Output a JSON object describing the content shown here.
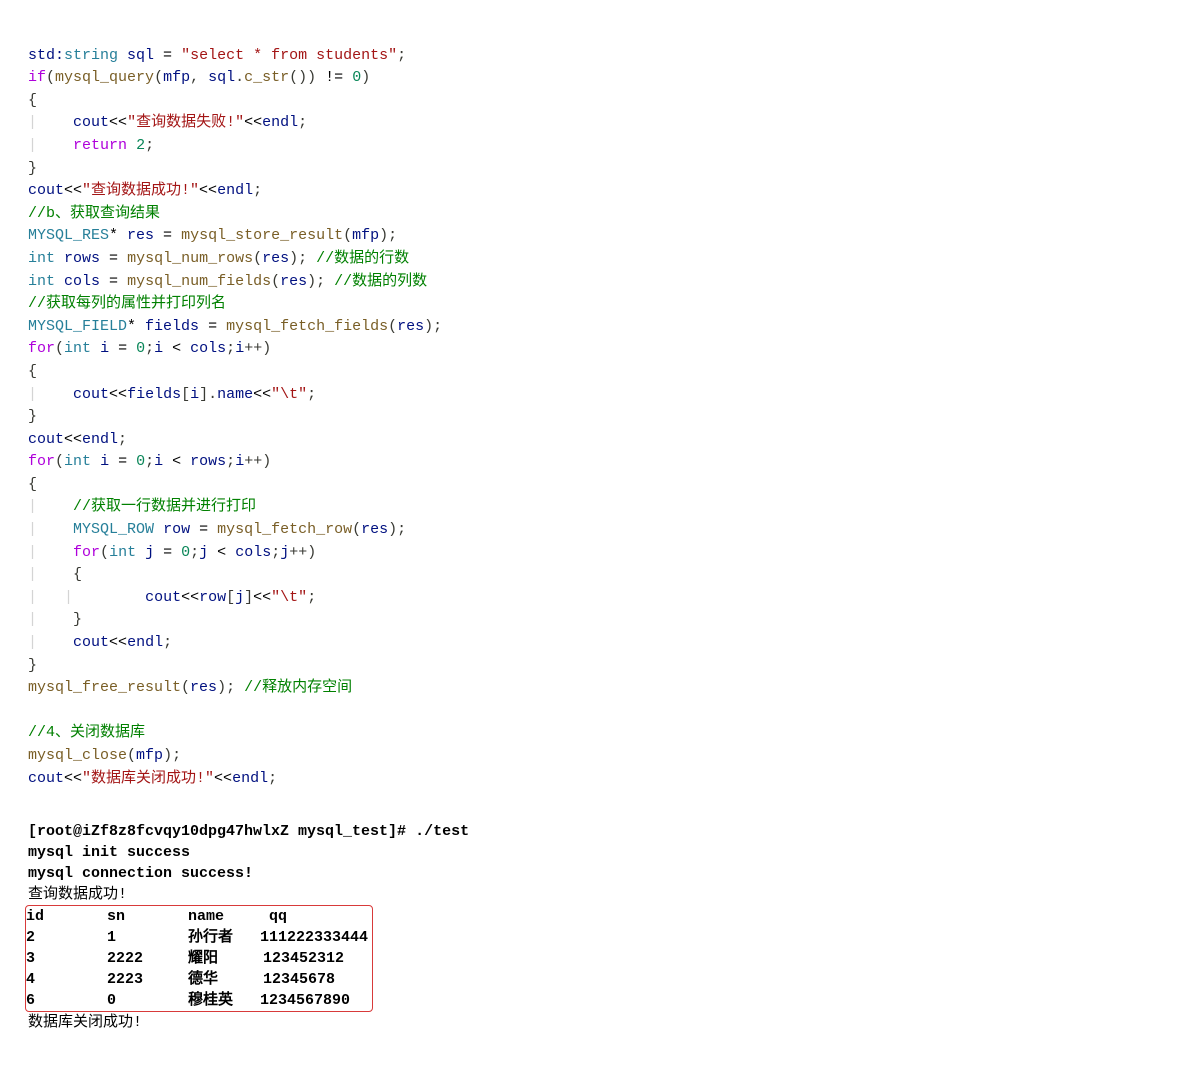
{
  "code": {
    "l01a": "std:",
    "l01b": "string",
    "l01c": " sql ",
    "l01d": "=",
    "l01e": " ",
    "l01f": "\"select * from students\"",
    "l01g": ";",
    "l02a": "if",
    "l02b": "(",
    "l02c": "mysql_query",
    "l02d": "(",
    "l02e": "mfp",
    "l02f": ", ",
    "l02g": "sql",
    "l02h": ".",
    "l02i": "c_str",
    "l02j": "()) ",
    "l02k": "!=",
    "l02l": " ",
    "l02m": "0",
    "l02n": ")",
    "l03": "{",
    "l04a": "    ",
    "l04b": "cout",
    "l04c": "<<",
    "l04d": "\"查询数据失败!\"",
    "l04e": "<<",
    "l04f": "endl",
    "l04g": ";",
    "l05a": "    ",
    "l05b": "return",
    "l05c": " ",
    "l05d": "2",
    "l05e": ";",
    "l06": "}",
    "l07a": "cout",
    "l07b": "<<",
    "l07c": "\"查询数据成功!\"",
    "l07d": "<<",
    "l07e": "endl",
    "l07f": ";",
    "l08": "//b、获取查询结果",
    "l09a": "MYSQL_RES",
    "l09b": "* ",
    "l09c": "res",
    "l09d": " = ",
    "l09e": "mysql_store_result",
    "l09f": "(",
    "l09g": "mfp",
    "l09h": ");",
    "l10a": "int",
    "l10b": " ",
    "l10c": "rows",
    "l10d": " = ",
    "l10e": "mysql_num_rows",
    "l10f": "(",
    "l10g": "res",
    "l10h": "); ",
    "l10i": "//数据的行数",
    "l11a": "int",
    "l11b": " ",
    "l11c": "cols",
    "l11d": " = ",
    "l11e": "mysql_num_fields",
    "l11f": "(",
    "l11g": "res",
    "l11h": "); ",
    "l11i": "//数据的列数",
    "l12": "//获取每列的属性并打印列名",
    "l13a": "MYSQL_FIELD",
    "l13b": "* ",
    "l13c": "fields",
    "l13d": " = ",
    "l13e": "mysql_fetch_fields",
    "l13f": "(",
    "l13g": "res",
    "l13h": ");",
    "l14a": "for",
    "l14b": "(",
    "l14c": "int",
    "l14d": " ",
    "l14e": "i",
    "l14f": " = ",
    "l14g": "0",
    "l14h": ";",
    "l14i": "i",
    "l14j": " < ",
    "l14k": "cols",
    "l14l": ";",
    "l14m": "i",
    "l14n": "++)",
    "l15": "{",
    "l16a": "    ",
    "l16b": "cout",
    "l16c": "<<",
    "l16d": "fields",
    "l16e": "[",
    "l16f": "i",
    "l16g": "].",
    "l16h": "name",
    "l16i": "<<",
    "l16j": "\"\\t\"",
    "l16k": ";",
    "l17": "}",
    "l18a": "cout",
    "l18b": "<<",
    "l18c": "endl",
    "l18d": ";",
    "l19a": "for",
    "l19b": "(",
    "l19c": "int",
    "l19d": " ",
    "l19e": "i",
    "l19f": " = ",
    "l19g": "0",
    "l19h": ";",
    "l19i": "i",
    "l19j": " < ",
    "l19k": "rows",
    "l19l": ";",
    "l19m": "i",
    "l19n": "++)",
    "l20": "{",
    "l21a": "    ",
    "l21b": "//获取一行数据并进行打印",
    "l22a": "    ",
    "l22b": "MYSQL_ROW",
    "l22c": " ",
    "l22d": "row",
    "l22e": " = ",
    "l22f": "mysql_fetch_row",
    "l22g": "(",
    "l22h": "res",
    "l22i": ");",
    "l23a": "    ",
    "l23b": "for",
    "l23c": "(",
    "l23d": "int",
    "l23e": " ",
    "l23f": "j",
    "l23g": " = ",
    "l23h": "0",
    "l23i": ";",
    "l23j": "j",
    "l23k": " < ",
    "l23l": "cols",
    "l23m": ";",
    "l23n": "j",
    "l23o": "++)",
    "l24a": "    ",
    "l24b": "{",
    "l25a": "        ",
    "l25b": "cout",
    "l25c": "<<",
    "l25d": "row",
    "l25e": "[",
    "l25f": "j",
    "l25g": "]",
    "l25h": "<<",
    "l25i": "\"\\t\"",
    "l25j": ";",
    "l26a": "    ",
    "l26b": "}",
    "l27a": "    ",
    "l27b": "cout",
    "l27c": "<<",
    "l27d": "endl",
    "l27e": ";",
    "l28": "}",
    "l29a": "mysql_free_result",
    "l29b": "(",
    "l29c": "res",
    "l29d": "); ",
    "l29e": "//释放内存空间",
    "l30": "",
    "l31": "//4、关闭数据库",
    "l32a": "mysql_close",
    "l32b": "(",
    "l32c": "mfp",
    "l32d": ");",
    "l33a": "cout",
    "l33b": "<<",
    "l33c": "\"数据库关闭成功!\"",
    "l33d": "<<",
    "l33e": "endl",
    "l33f": ";",
    "pipe": "|"
  },
  "term": {
    "prompt": "[root@iZf8z8fcvqy10dpg47hwlxZ mysql_test]# ./test",
    "l2": "mysql init success",
    "l3": "mysql connection success!",
    "l4": "查询数据成功!",
    "header": "id       sn       name     qq",
    "r1": "2        1        孙行者   111222333444",
    "r2": "3        2222     耀阳     123452312",
    "r3": "4        2223     德华     12345678",
    "r4": "6        0        穆桂英   1234567890",
    "last": "数据库关闭成功!"
  }
}
